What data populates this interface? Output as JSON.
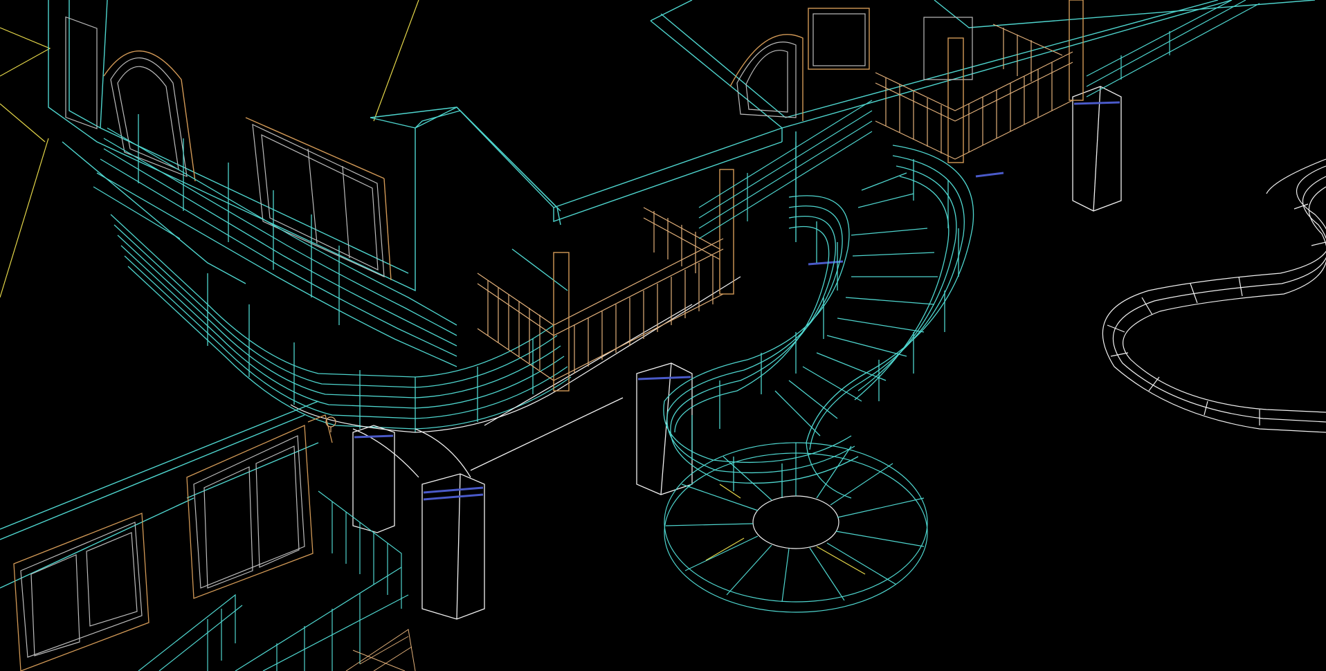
{
  "viewport": {
    "background": "#000000",
    "palette": {
      "railing": "#4fd6cf",
      "structure": "#f2f2f2",
      "roof_edge": "#e6d84a",
      "baluster": "#e2b07a",
      "post": "#d39a57",
      "post_band": "#4a5ac9",
      "window_frame": "#bdbdbd"
    },
    "icons": [
      "wireframe-house-icon",
      "spiral-staircase-icon",
      "curved-walkway-icon"
    ]
  }
}
